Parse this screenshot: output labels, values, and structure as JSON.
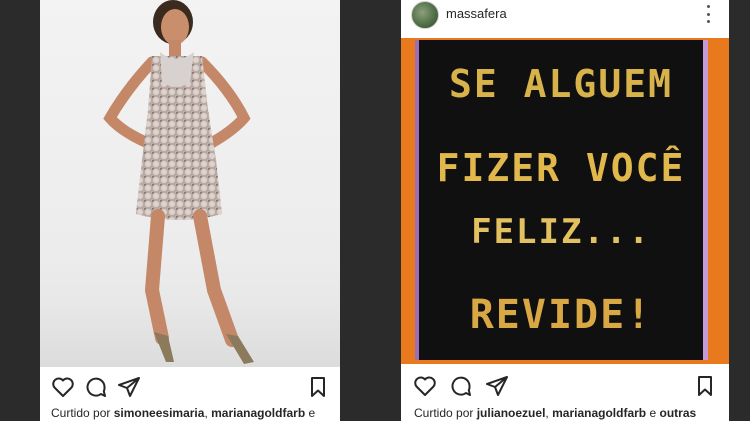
{
  "left_post": {
    "likes": {
      "prefix": "Curtido por",
      "user1": "simoneesimaria",
      "separator": ",",
      "user2": "marianagoldfarb",
      "suffix": "e"
    },
    "icons": [
      "heart-icon",
      "comment-icon",
      "share-icon",
      "bookmark-icon"
    ]
  },
  "right_post": {
    "username": "massafera",
    "chalkboard": {
      "line1": "SE ALGUEM",
      "line2": "FIZER VOCÊ",
      "line3": "FELIZ...",
      "line4": "REVIDE!"
    },
    "likes": {
      "prefix": "Curtido por",
      "user1": "julianoezuel",
      "separator": ",",
      "user2": "marianagoldfarb",
      "suffix": "e",
      "more": "outras"
    },
    "icons": [
      "heart-icon",
      "comment-icon",
      "share-icon",
      "bookmark-icon",
      "more-options-icon"
    ]
  },
  "colors": {
    "background": "#2b2b2b",
    "chalk": "#d8b24a",
    "board": "#101010",
    "board_frame": "#c59ad6"
  }
}
